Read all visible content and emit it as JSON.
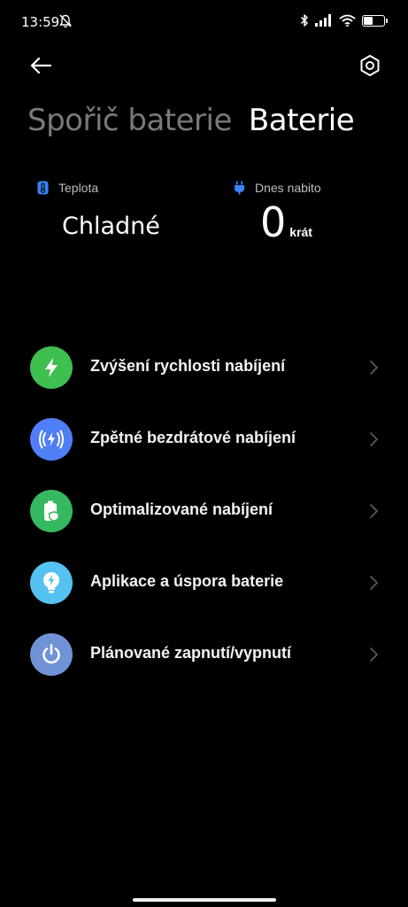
{
  "status_bar": {
    "time": "13:59",
    "battery_level": "46",
    "battery_fill": 0.46,
    "icons": [
      "dnd-off-icon",
      "bluetooth-icon",
      "signal-icon",
      "wifi-icon",
      "battery-icon"
    ]
  },
  "header": {
    "back_icon": "arrow-left-icon",
    "settings_icon": "gear-icon",
    "tabs": [
      {
        "label": "Spořič baterie",
        "active": false
      },
      {
        "label": "Baterie",
        "active": true
      }
    ]
  },
  "stats": {
    "temperature": {
      "label": "Teplota",
      "value": "Chladné",
      "icon": "thermometer-icon"
    },
    "charged_today": {
      "label": "Dnes nabito",
      "value": "0",
      "unit": "krát",
      "icon": "plug-icon"
    }
  },
  "menu": [
    {
      "label": "Zvýšení rychlosti nabíjení",
      "icon": "lightning-icon",
      "color": "#3fbf4f"
    },
    {
      "label": "Zpětné bezdrátové nabíjení",
      "icon": "wireless-charging-icon",
      "color": "#4f7ef6"
    },
    {
      "label": "Optimalizované nabíjení",
      "icon": "battery-shield-icon",
      "color": "#36b860"
    },
    {
      "label": "Aplikace a úspora baterie",
      "icon": "bulb-icon",
      "color": "#55c2f1"
    },
    {
      "label": "Plánované zapnutí/vypnutí",
      "icon": "power-icon",
      "color": "#6f93d6"
    }
  ],
  "colors": {
    "background": "#000000",
    "inactive_tab": "#7a7a7a",
    "stat_icon_blue": "#3a82f7"
  }
}
